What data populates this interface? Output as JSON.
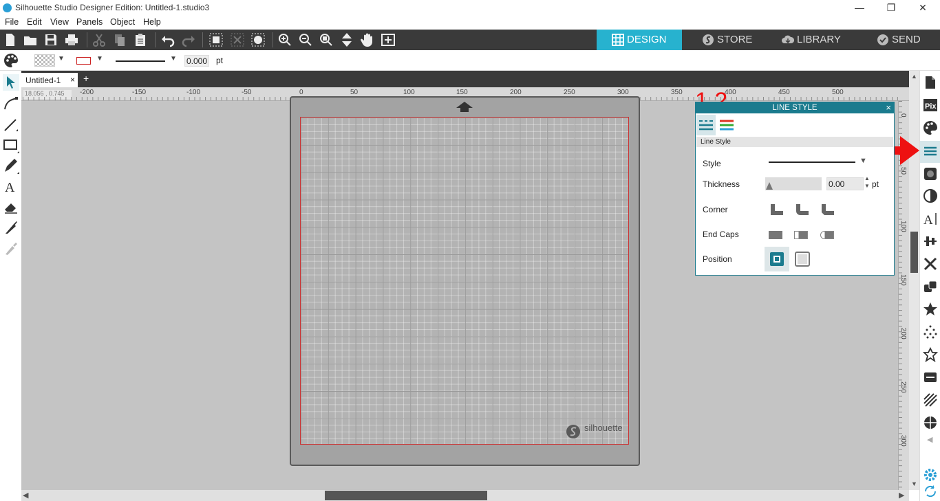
{
  "window": {
    "title": "Silhouette Studio Designer Edition: Untitled-1.studio3",
    "minimize_icon": "minimize-icon",
    "restore_icon": "restore-icon",
    "close_icon": "close-icon"
  },
  "menu": [
    "File",
    "Edit",
    "View",
    "Panels",
    "Object",
    "Help"
  ],
  "nav_tabs": [
    {
      "label": "DESIGN",
      "icon": "grid-icon",
      "active": true
    },
    {
      "label": "STORE",
      "icon": "silhouette-s-icon",
      "active": false
    },
    {
      "label": "LIBRARY",
      "icon": "cloud-download-icon",
      "active": false
    },
    {
      "label": "SEND",
      "icon": "checkmark-icon",
      "active": false
    }
  ],
  "options_bar": {
    "line_thickness_value": "0.000",
    "line_thickness_unit": "pt"
  },
  "document_tab": {
    "name": "Untitled-1",
    "close": "×",
    "add": "+"
  },
  "cursor_readout": "18.056 , 0.745",
  "ruler": {
    "horizontal": [
      "-200",
      "-150",
      "-100",
      "-50",
      "0",
      "50",
      "100",
      "150",
      "200",
      "250",
      "300",
      "350",
      "400",
      "450",
      "500"
    ],
    "vertical": [
      "0",
      "50",
      "100",
      "150",
      "200",
      "250",
      "300"
    ]
  },
  "mat": {
    "brand": "silhouette"
  },
  "annotation": {
    "steps": "1.2."
  },
  "line_style_panel": {
    "title": "LINE STYLE",
    "close": "×",
    "section": "Line Style",
    "style_label": "Style",
    "thickness_label": "Thickness",
    "thickness_value": "0.00",
    "thickness_unit": "pt",
    "corner_label": "Corner",
    "end_caps_label": "End Caps",
    "position_label": "Position"
  },
  "colors": {
    "accent": "#1b7b8e",
    "design_tab": "#27b2cf",
    "annotation_red": "#ee1111",
    "toolbar": "#3a3a3a"
  }
}
